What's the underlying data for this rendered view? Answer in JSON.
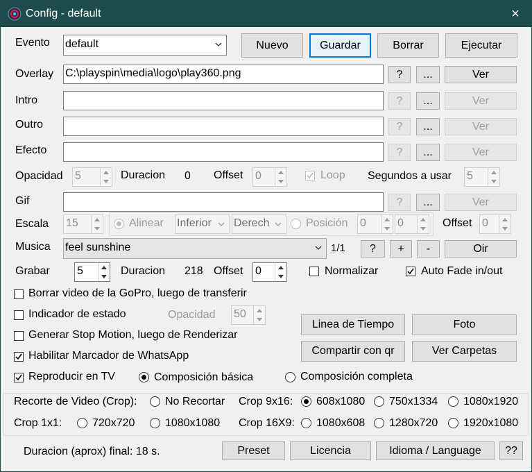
{
  "window": {
    "title": "Config - default",
    "close_icon": "×"
  },
  "labels": {
    "evento": "Evento",
    "overlay": "Overlay",
    "intro": "Intro",
    "outro": "Outro",
    "efecto": "Efecto",
    "opacidad": "Opacidad",
    "duracion": "Duracion",
    "offset": "Offset",
    "loop": "Loop",
    "segundos": "Segundos a usar",
    "gif": "Gif",
    "escala": "Escala",
    "alinear": "Alinear",
    "posicion": "Posición",
    "musica": "Musica",
    "grabar": "Grabar",
    "normalizar": "Normalizar",
    "auto_fade": "Auto Fade in/out",
    "opacidad2": "Opacidad",
    "duracion_final": "Duracion (aprox) final: 18 s."
  },
  "evento": {
    "value": "default"
  },
  "top_buttons": {
    "nuevo": "Nuevo",
    "guardar": "Guardar",
    "borrar": "Borrar",
    "ejecutar": "Ejecutar"
  },
  "overlay": {
    "value": "C:\\playspin\\media\\logo\\play360.png"
  },
  "intro": {
    "value": ""
  },
  "outro": {
    "value": ""
  },
  "efecto": {
    "value": ""
  },
  "gif": {
    "value": ""
  },
  "row_buttons": {
    "help": "?",
    "browse": "...",
    "ver": "Ver"
  },
  "opacidad_row": {
    "opacidad": "5",
    "duracion": "0",
    "offset": "0",
    "segundos": "5"
  },
  "escala_row": {
    "escala": "15",
    "vertical": "Inferior",
    "horizontal": "Derech",
    "pos_x": "0",
    "pos_y": "0",
    "offset": "0"
  },
  "musica": {
    "value": "feel sunshine",
    "count": "1/1",
    "help": "?",
    "plus": "+",
    "minus": "-",
    "oir": "Oir"
  },
  "grabar": {
    "value": "5",
    "duracion": "218",
    "offset": "0"
  },
  "options": {
    "borrar_gopro": "Borrar video de la GoPro, luego de transferir",
    "indicador": "Indicador de estado",
    "opacidad_value": "50",
    "stop_motion": "Generar Stop Motion, luego de Renderizar",
    "whatsapp": "Habilitar Marcador de WhatsApp",
    "tv": "Reproducir en TV",
    "comp_basica": "Composición básica",
    "comp_completa": "Composición completa"
  },
  "action_buttons": {
    "linea": "Linea de Tiempo",
    "foto": "Foto",
    "compartir": "Compartir con qr",
    "carpetas": "Ver Carpetas"
  },
  "crop": {
    "label": "Recorte de Video (Crop):",
    "no_recortar": "No Recortar",
    "crop916": "Crop 9x16:",
    "opt_608": "608x1080",
    "opt_750": "750x1334",
    "opt_1080v": "1080x1920",
    "crop11": "Crop 1x1:",
    "opt_720": "720x720",
    "opt_1080sq": "1080x1080",
    "crop169": "Crop 16X9:",
    "opt_1080h": "1080x608",
    "opt_1280": "1280x720",
    "opt_1920": "1920x1080"
  },
  "bottom_buttons": {
    "preset": "Preset",
    "licencia": "Licencia",
    "idioma": "Idioma / Language",
    "help": "??"
  },
  "colors": {
    "titlebar": "#1e4c4c",
    "focus": "#0078d7",
    "window_bg": "#f0f0f0"
  }
}
